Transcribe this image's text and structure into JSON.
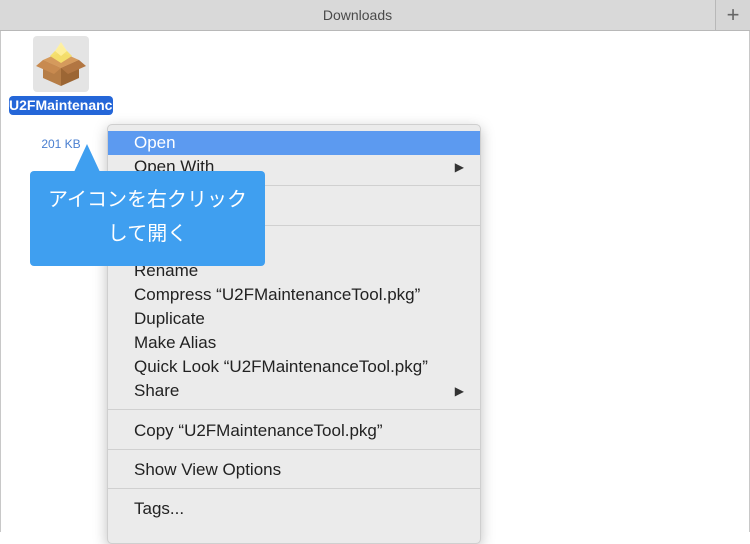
{
  "window": {
    "tab_title": "Downloads",
    "new_tab_label": "+"
  },
  "file": {
    "name": "U2FMaintenanceTool.pkg",
    "size": "201 KB"
  },
  "menu": {
    "items": [
      {
        "label": "Open",
        "active": true,
        "submenu": false
      },
      {
        "label": "Open With",
        "active": false,
        "submenu": true
      },
      {
        "label": "Rename",
        "active": false,
        "submenu": false
      },
      {
        "label": "Compress “U2FMaintenanceTool.pkg”",
        "active": false,
        "submenu": false
      },
      {
        "label": "Duplicate",
        "active": false,
        "submenu": false
      },
      {
        "label": "Make Alias",
        "active": false,
        "submenu": false
      },
      {
        "label": "Quick Look “U2FMaintenanceTool.pkg”",
        "active": false,
        "submenu": false
      },
      {
        "label": "Share",
        "active": false,
        "submenu": true
      },
      {
        "label": "Copy “U2FMaintenanceTool.pkg”",
        "active": false,
        "submenu": false
      },
      {
        "label": "Show View Options",
        "active": false,
        "submenu": false
      },
      {
        "label": "Tags...",
        "active": false,
        "submenu": false
      }
    ],
    "submenu_arrow": "▶"
  },
  "callout": {
    "line1": "アイコンを右クリック",
    "line2": "して開く"
  },
  "colors": {
    "selection": "#2466d8",
    "menu_highlight": "#5c9af0",
    "callout": "#3f9ff0"
  }
}
